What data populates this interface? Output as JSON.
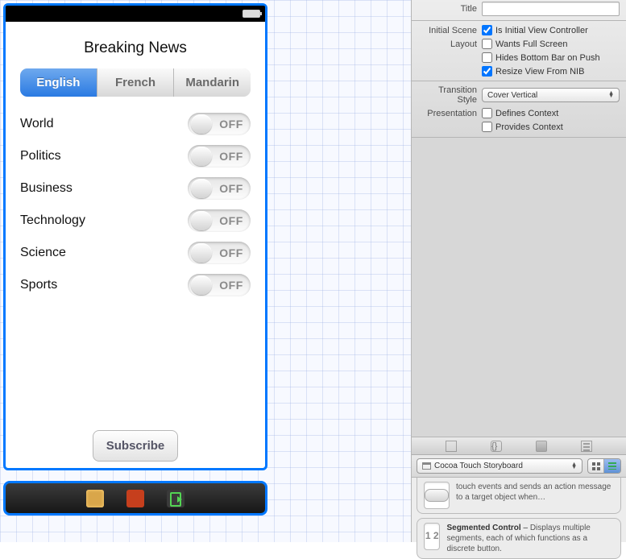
{
  "app": {
    "title": "Breaking News",
    "segments": [
      "English",
      "French",
      "Mandarin"
    ],
    "categories": [
      "World",
      "Politics",
      "Business",
      "Technology",
      "Science",
      "Sports"
    ],
    "switch_off": "OFF",
    "subscribe": "Subscribe"
  },
  "inspector": {
    "title_label": "Title",
    "initial_scene_label": "Initial Scene",
    "is_initial": "Is Initial View Controller",
    "layout_label": "Layout",
    "wants_full": "Wants Full Screen",
    "hides_bottom": "Hides Bottom Bar on Push",
    "resize_nib": "Resize View From NIB",
    "transition_label": "Transition Style",
    "transition_value": "Cover Vertical",
    "presentation_label": "Presentation",
    "defines_ctx": "Defines Context",
    "provides_ctx": "Provides Context"
  },
  "library": {
    "filter": "Cocoa Touch Storyboard",
    "item_partial": "touch events and sends an action message to a target object when…",
    "seg_title": "Segmented Control",
    "seg_sep": " – ",
    "seg_desc": "Displays multiple segments, each of which functions as a discrete button.",
    "seg_thumb": "1  2"
  }
}
